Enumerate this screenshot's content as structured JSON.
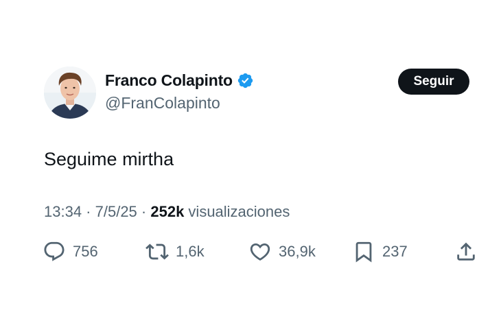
{
  "author": {
    "display_name": "Franco Colapinto",
    "handle": "@FranColapinto",
    "verified": true,
    "avatar_icon": "profile-photo"
  },
  "follow_label": "Seguir",
  "tweet": {
    "text": "Seguime mirtha"
  },
  "meta": {
    "time": "13:34",
    "separator1": " · ",
    "date": "7/5/25",
    "separator2": " · ",
    "views_count": "252k",
    "views_label": " visualizaciones"
  },
  "actions": {
    "replies": "756",
    "retweets": "1,6k",
    "likes": "36,9k",
    "bookmarks": "237"
  },
  "colors": {
    "text_primary": "#0f1419",
    "text_secondary": "#536471",
    "verified_blue": "#1d9bf0",
    "button_bg": "#0f1419"
  }
}
